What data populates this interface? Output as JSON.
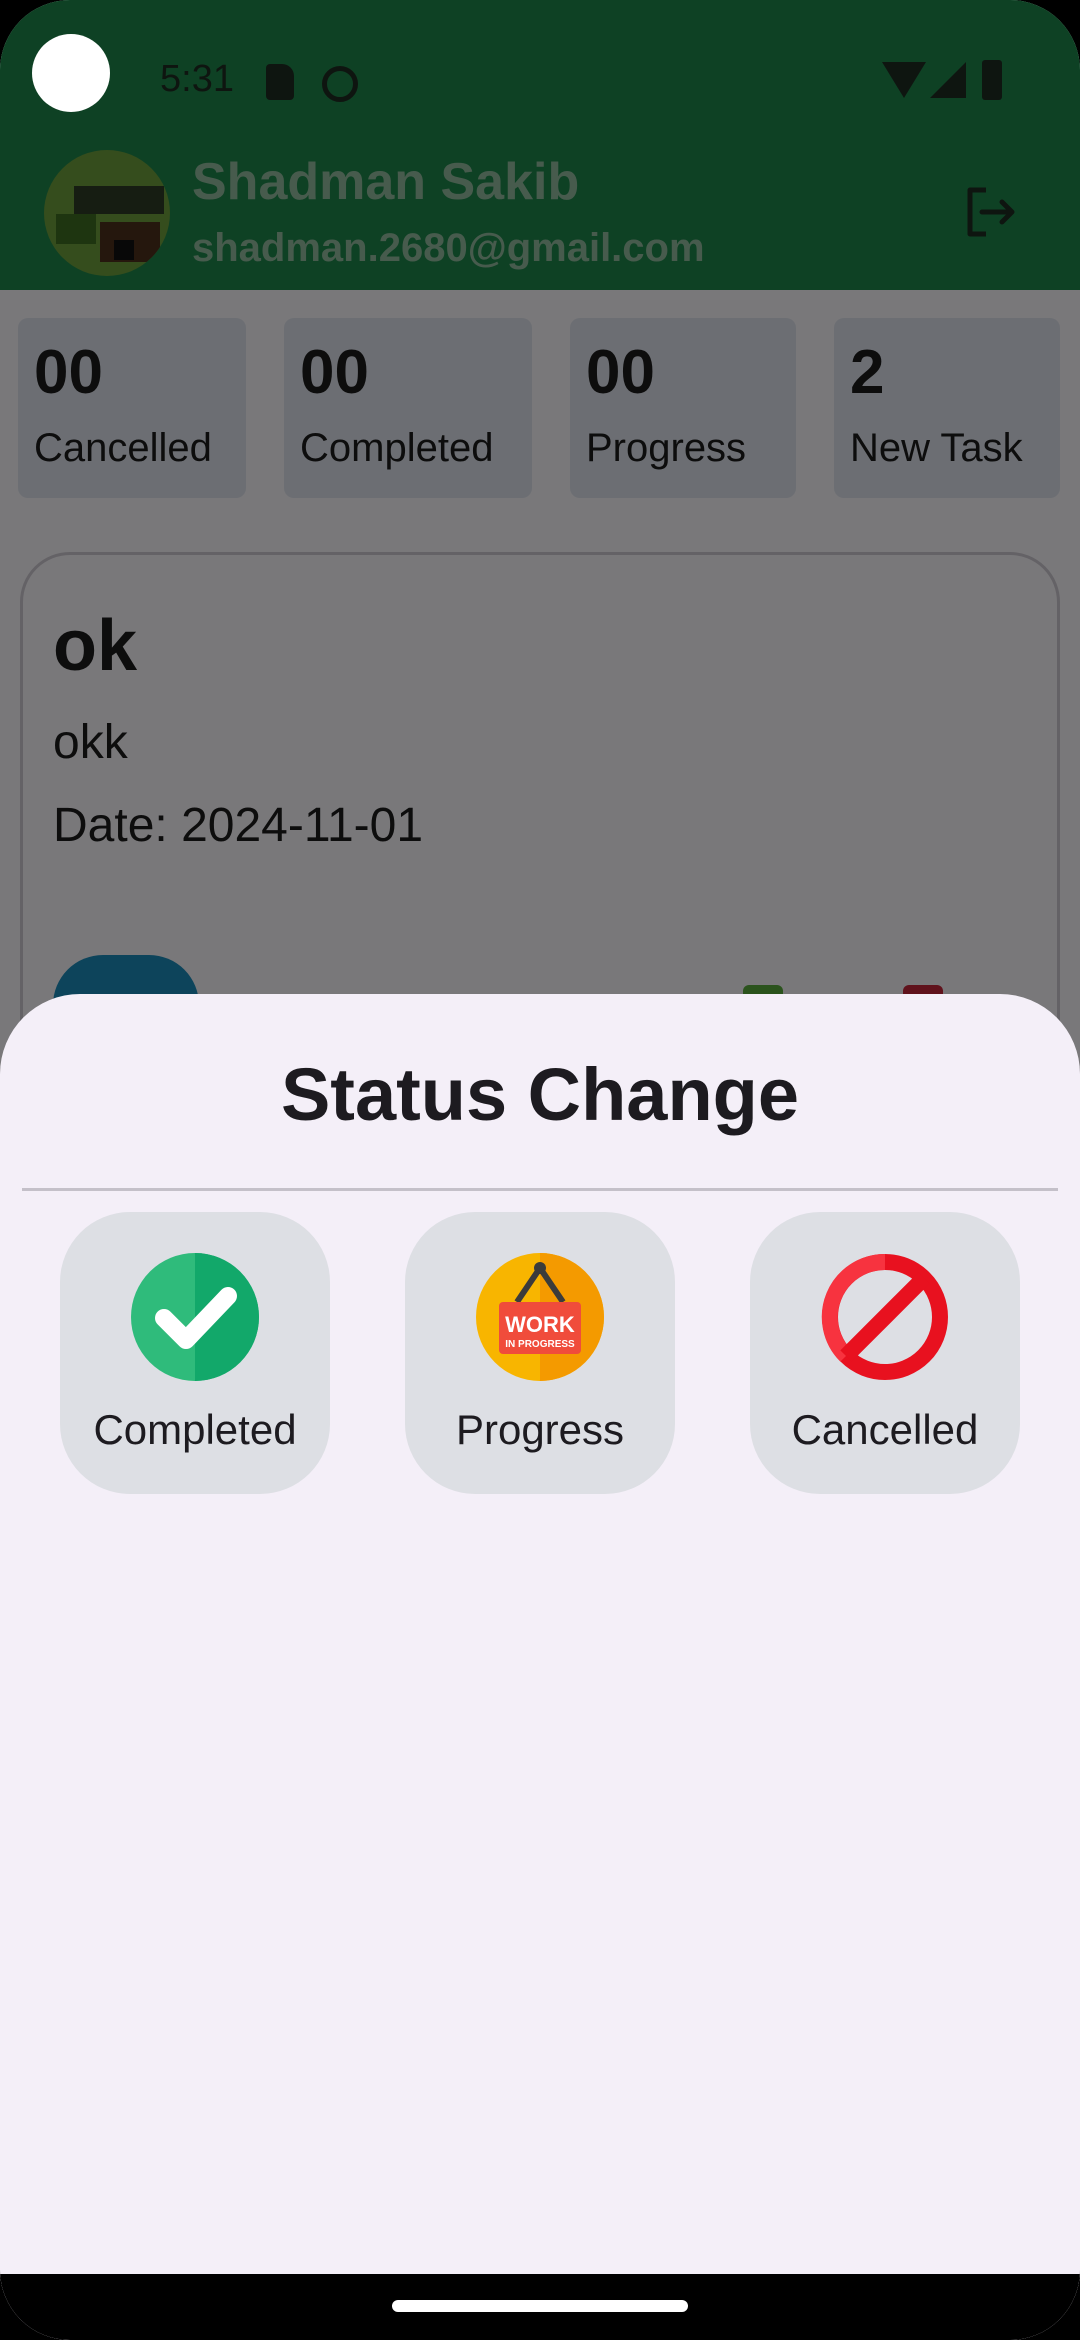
{
  "status_bar": {
    "time": "5:31"
  },
  "user": {
    "name": "Shadman Sakib",
    "email": "shadman.2680@gmail.com"
  },
  "stats": [
    {
      "count": "00",
      "label": "Cancelled"
    },
    {
      "count": "00",
      "label": "Completed"
    },
    {
      "count": "00",
      "label": "Progress"
    },
    {
      "count": "2",
      "label": "New Task"
    }
  ],
  "task": {
    "title": "ok",
    "description": "okk",
    "date": "Date: 2024-11-01"
  },
  "sheet": {
    "title": "Status Change",
    "options": [
      {
        "label": "Completed",
        "icon": "check-circle-icon"
      },
      {
        "label": "Progress",
        "icon": "work-in-progress-icon"
      },
      {
        "label": "Cancelled",
        "icon": "forbidden-icon"
      }
    ],
    "progress_icon_text": [
      "WORK",
      "IN PROGRESS"
    ]
  },
  "colors": {
    "header": "#1d8249",
    "sheet_bg": "#f4eff8",
    "option_bg": "#dddfe4",
    "completed_green": "#2fbb7b",
    "progress_yellow": "#f8b500",
    "cancelled_red": "#e8111f"
  }
}
